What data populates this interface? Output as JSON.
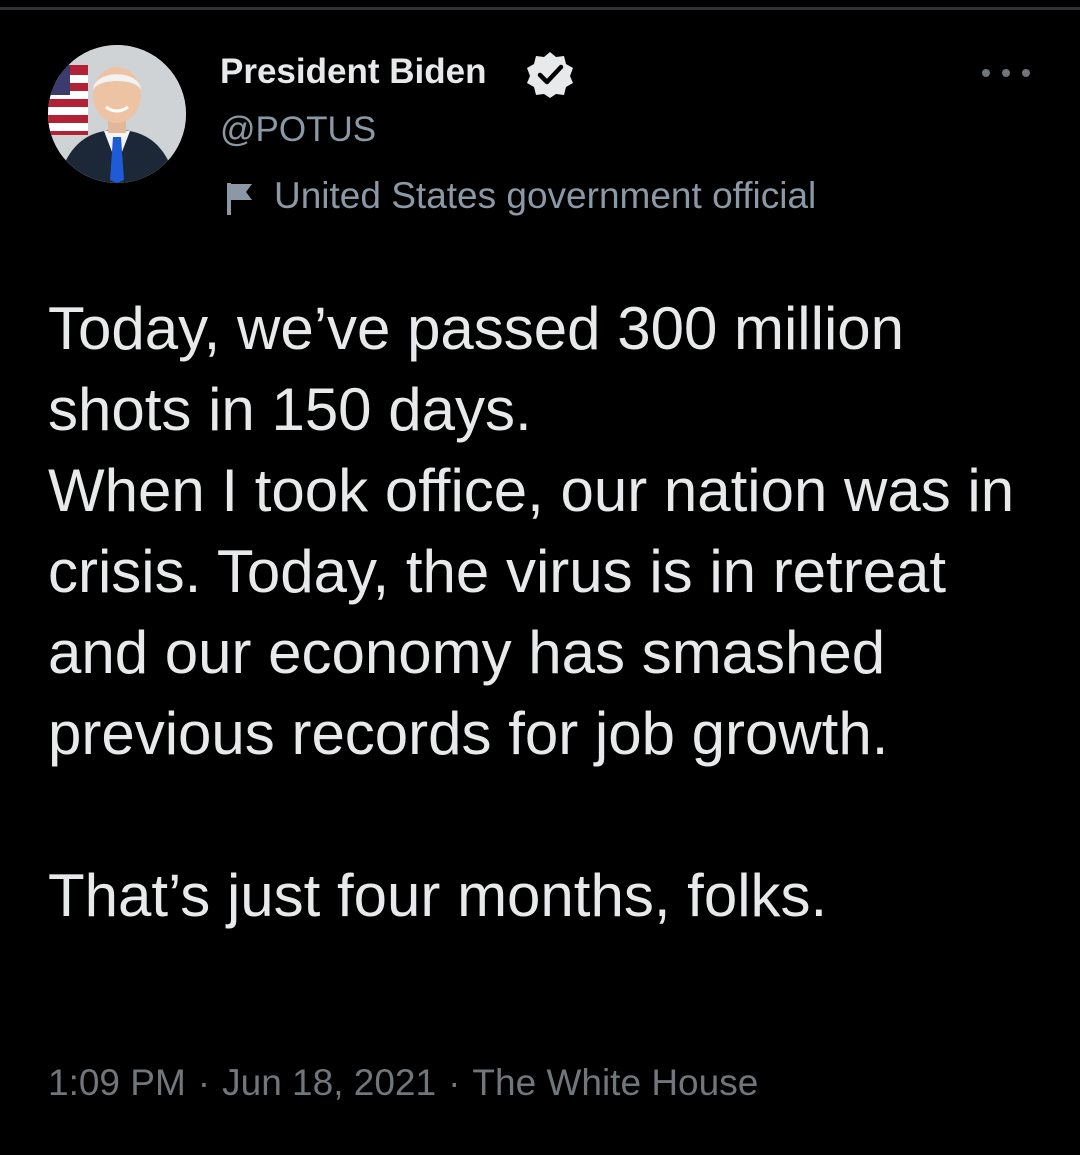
{
  "author": {
    "display_name": "President Biden",
    "handle": "@POTUS",
    "verified": true,
    "label": "United States government official"
  },
  "icons": {
    "verified": "verified-badge-icon",
    "flag": "flag-icon",
    "more": "more-options-icon"
  },
  "tweet": {
    "text": "Today, we’ve passed 300 million shots in 150 days.\nWhen I took office, our nation was in crisis. Today, the virus is in retreat and our economy has smashed previous records for job growth.\n\nThat’s just four months, folks."
  },
  "meta": {
    "time": "1:09 PM",
    "date": "Jun 18, 2021",
    "source": "The White House",
    "separator": "·"
  },
  "colors": {
    "background": "#000000",
    "primary_text": "#e7e9ea",
    "secondary_text": "#71767b"
  }
}
